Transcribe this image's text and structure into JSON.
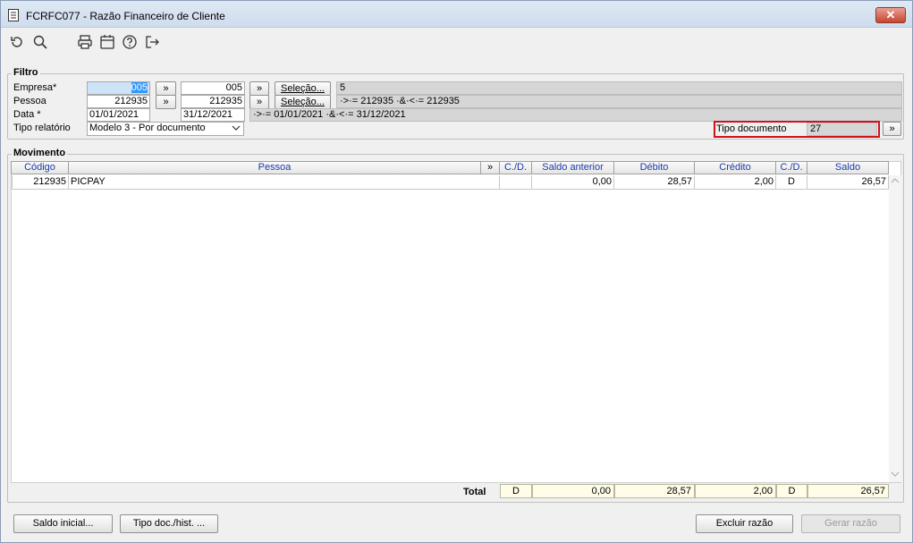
{
  "window": {
    "title": "FCRFC077 - Razão Financeiro de Cliente",
    "close": "✕"
  },
  "toolbar": {
    "icons": [
      "refresh-icon",
      "search-icon",
      "print-icon",
      "calendar-icon",
      "help-icon",
      "exit-icon"
    ]
  },
  "filtro": {
    "title": "Filtro",
    "empresa": {
      "label": "Empresa*",
      "from": "005",
      "to": "005",
      "selecao": "Seleção...",
      "info": "5"
    },
    "pessoa": {
      "label": "Pessoa",
      "from": "212935",
      "to": "212935",
      "selecao": "Seleção...",
      "info": "·>·= 212935 ·&·<·= 212935"
    },
    "data": {
      "label": "Data *",
      "from": "01/01/2021",
      "to": "31/12/2021",
      "info": "·>·= 01/01/2021 ·&·<·= 31/12/2021"
    },
    "tipo_relatorio": {
      "label": "Tipo relatório",
      "value": "Modelo 3 - Por documento"
    },
    "tipo_documento": {
      "label": "Tipo documento",
      "value": "27"
    },
    "more_button": "»"
  },
  "movimento": {
    "title": "Movimento",
    "columns": [
      "Código",
      "Pessoa",
      "»",
      "C./D.",
      "Saldo anterior",
      "Débito",
      "Crédito",
      "C./D.",
      "Saldo"
    ],
    "rows": [
      {
        "codigo": "212935",
        "pessoa": "PICPAY",
        "cd1": "",
        "saldo_anterior": "0,00",
        "debito": "28,57",
        "credito": "2,00",
        "cd2": "D",
        "saldo": "26,57"
      }
    ],
    "total": {
      "label": "Total",
      "cd1": "D",
      "saldo_anterior": "0,00",
      "debito": "28,57",
      "credito": "2,00",
      "cd2": "D",
      "saldo": "26,57"
    }
  },
  "buttons": {
    "saldo_inicial": "Saldo inicial...",
    "tipo_doc_hist": "Tipo doc./hist. ...",
    "excluir_razao": "Excluir razão",
    "gerar_razao": "Gerar razão"
  }
}
